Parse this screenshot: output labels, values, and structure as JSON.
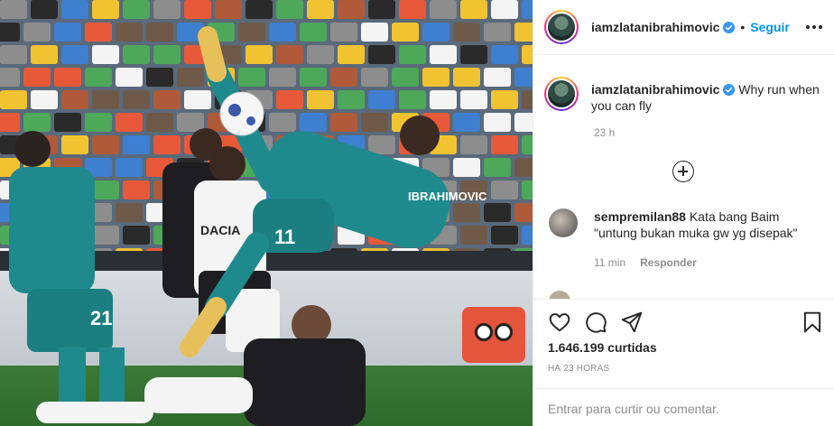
{
  "post": {
    "image_alt": "Zlatan Ibrahimovic bicycle kick",
    "jersey_name": "IBRAHIMOVIC",
    "jersey_number": "11"
  },
  "header": {
    "username": "iamzlatanibrahimovic",
    "separator": "•",
    "follow_label": "Seguir"
  },
  "caption": {
    "username": "iamzlatanibrahimovic",
    "text": "Why run when you can fly",
    "time": "23 h"
  },
  "comments": [
    {
      "username": "sempremilan88",
      "text": "Kata bang Baim \"untung bukan muka gw yg disepak\"",
      "time": "11 min",
      "reply_label": "Responder"
    }
  ],
  "actions": {
    "likes": "1.646.199 curtidas",
    "posted": "HÁ 23 HORAS"
  },
  "add_comment": {
    "placeholder": "Entrar para curtir ou comentar."
  },
  "colors": {
    "accent": "#0095f6",
    "verified": "#3897f0",
    "milan_teal": "#1f8a8e"
  }
}
